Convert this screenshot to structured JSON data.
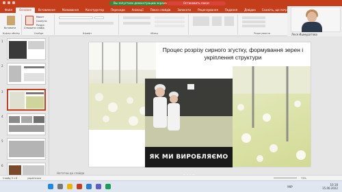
{
  "titlebar": {
    "presenting_label": "Вы запустили демонстрацию экрана",
    "stop_label": "Остановить показ"
  },
  "tabs": [
    "Файл",
    "Основне",
    "Вставлення",
    "Малювання",
    "Конструктор",
    "Переходи",
    "Анімації",
    "Показ слайдів",
    "Записати",
    "Рецензування",
    "Подання",
    "Довідка"
  ],
  "active_tab": "Основне",
  "tell_me": "Скажіть, що потрібно зробити",
  "ribbon": {
    "groups": [
      "Буфер обміну",
      "Слайди",
      "Шрифт",
      "Абзац",
      "Редагування"
    ],
    "paste": "Вставити",
    "new_slide": "Створити слайд",
    "side_cmds": [
      "Макет",
      "Скинути",
      "Розділ"
    ]
  },
  "webcam": {
    "name": "Леся Ишмуратова"
  },
  "slides": [
    {
      "num": "1"
    },
    {
      "num": "2"
    },
    {
      "num": "3"
    },
    {
      "num": "4"
    },
    {
      "num": "5"
    },
    {
      "num": "6"
    }
  ],
  "slide": {
    "title": "Процес розрізу сирного згустку, формування зерен і укріплення структури",
    "video_caption": "ЯК МИ ВИРОБЛЯЄМО СИР"
  },
  "notes_placeholder": "Нотатки до слайда",
  "status": {
    "slide_counter": "Слайд 3 з 6",
    "language": "українська",
    "zoom": "73%"
  },
  "taskbar": {
    "time": "10:18",
    "date": "15.06.2022",
    "lang": "УКР"
  },
  "colors": {
    "accent": "#c43e1c"
  }
}
